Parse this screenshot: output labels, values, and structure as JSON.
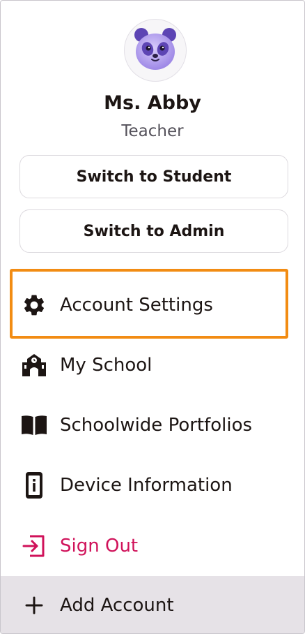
{
  "user": {
    "name": "Ms. Abby",
    "role": "Teacher",
    "avatar_icon": "panda-avatar-icon"
  },
  "switch_buttons": {
    "student_label": "Switch to Student",
    "admin_label": "Switch to Admin"
  },
  "menu": {
    "account_settings": {
      "label": "Account Settings",
      "icon": "gear-icon"
    },
    "my_school": {
      "label": "My School",
      "icon": "school-icon"
    },
    "schoolwide_portfolios": {
      "label": "Schoolwide Portfolios",
      "icon": "book-icon"
    },
    "device_information": {
      "label": "Device Information",
      "icon": "device-info-icon"
    },
    "sign_out": {
      "label": "Sign Out",
      "icon": "sign-out-icon"
    },
    "add_account": {
      "label": "Add Account",
      "icon": "plus-icon"
    }
  },
  "colors": {
    "text": "#1c1513",
    "muted": "#55525b",
    "focus_ring": "#f28c13",
    "sign_out": "#d0125a",
    "add_account_bg": "#e6e2e7"
  }
}
